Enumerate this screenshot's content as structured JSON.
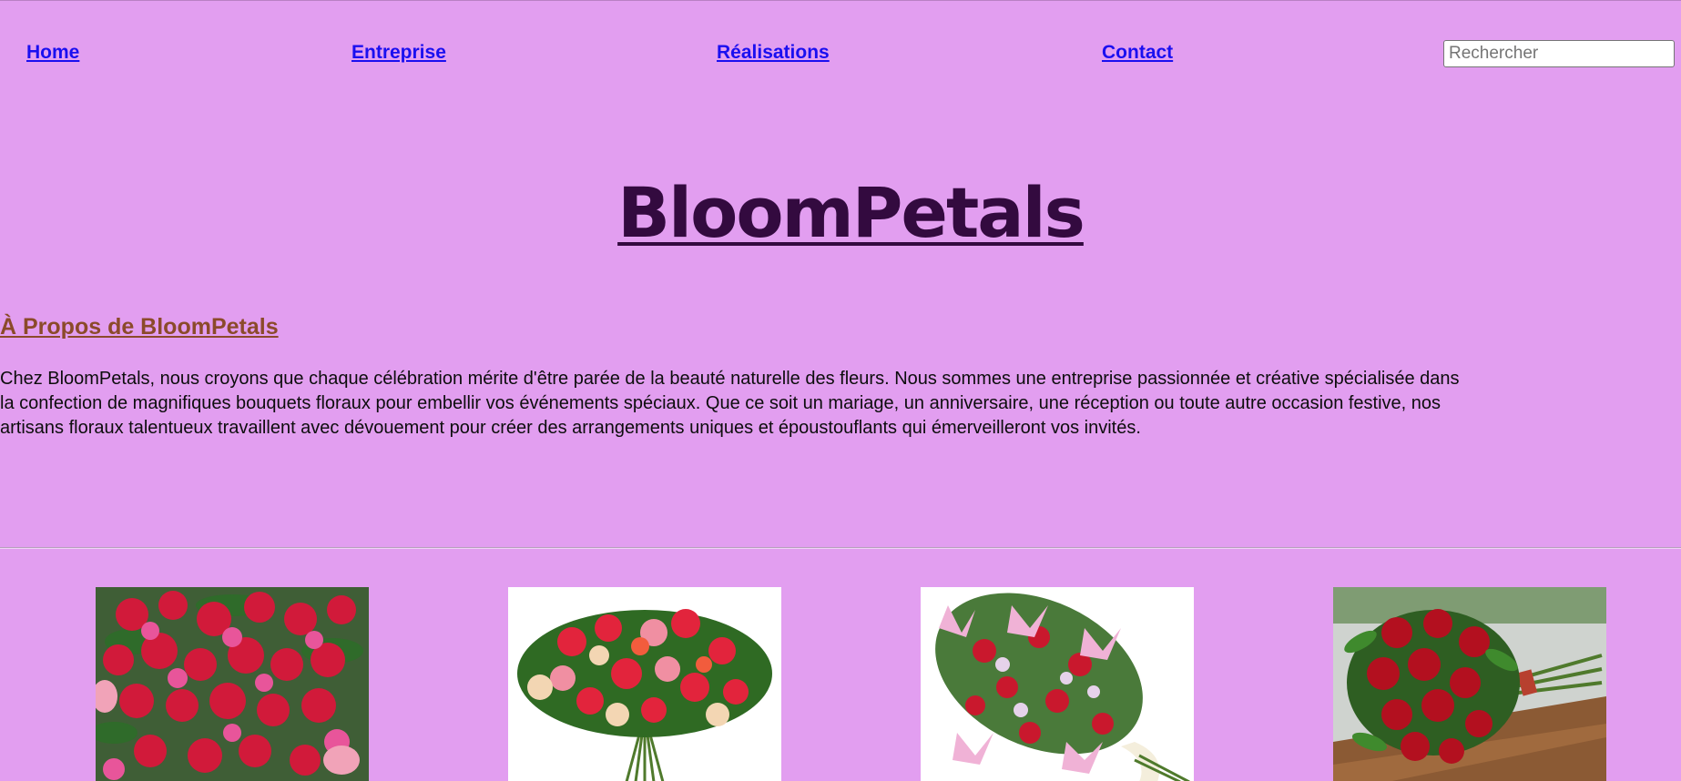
{
  "nav": {
    "home": "Home",
    "entreprise": "Entreprise",
    "realisations": "Réalisations",
    "contact": "Contact"
  },
  "search": {
    "placeholder": "Rechercher",
    "value": ""
  },
  "header": {
    "title": "BloomPetals"
  },
  "about": {
    "heading": "À Propos de BloomPetals",
    "lines": [
      "Chez BloomPetals, nous croyons que chaque célébration mérite d'être parée de la beauté naturelle des fleurs. Nous sommes une entreprise passionnée et créative spécialisée dans",
      "la confection de magnifiques bouquets floraux pour embellir vos événements spéciaux. Que ce soit un mariage, un anniversaire, une réception ou toute autre occasion festive, nos",
      "artisans floraux talentueux travaillent avec dévouement pour créer des arrangements uniques et époustouflants qui émerveilleront vos invités."
    ]
  },
  "gallery": {
    "images": [
      {
        "icon": "bouquet-red-pink-roses-image"
      },
      {
        "icon": "bouquet-mixed-roses-image"
      },
      {
        "icon": "bouquet-lilies-roses-image"
      },
      {
        "icon": "bouquet-red-roses-wood-table-image"
      }
    ]
  },
  "colors": {
    "background": "#e29ef0",
    "link": "#1a0ff0",
    "title": "#330a3f",
    "about_heading": "#8b4a2a"
  }
}
